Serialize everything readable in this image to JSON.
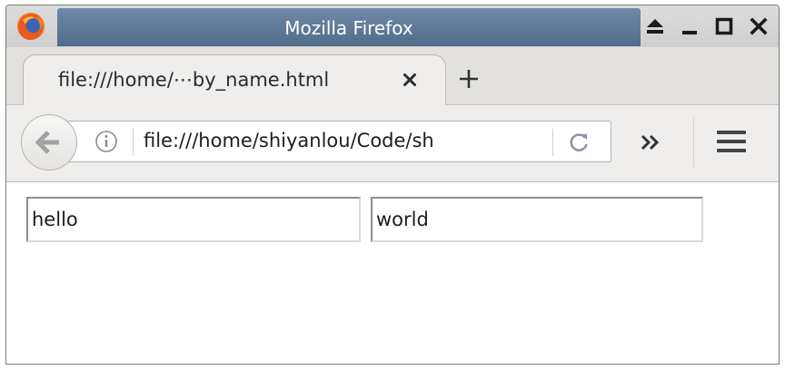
{
  "window": {
    "title": "Mozilla Firefox"
  },
  "tabs": [
    {
      "label": "file:///home/⋯by_name.html",
      "active": true
    }
  ],
  "navbar": {
    "url": "file:///home/shiyanlou/Code/sh"
  },
  "icons": {
    "logo": "firefox-logo-icon",
    "eject": "eject-icon",
    "minimize": "minimize-icon",
    "maximize": "maximize-icon",
    "close": "close-icon",
    "tab_close": "tab-close-icon",
    "new_tab": "plus-icon",
    "back": "back-arrow-icon",
    "info": "info-icon",
    "reload": "reload-icon",
    "overflow": "double-chevron-icon",
    "menu": "hamburger-menu-icon"
  },
  "content": {
    "inputs": [
      {
        "value": "hello"
      },
      {
        "value": "world"
      }
    ]
  },
  "colors": {
    "titlebar_accent": "#4f6c8a",
    "toolbar": "#efeeec"
  }
}
